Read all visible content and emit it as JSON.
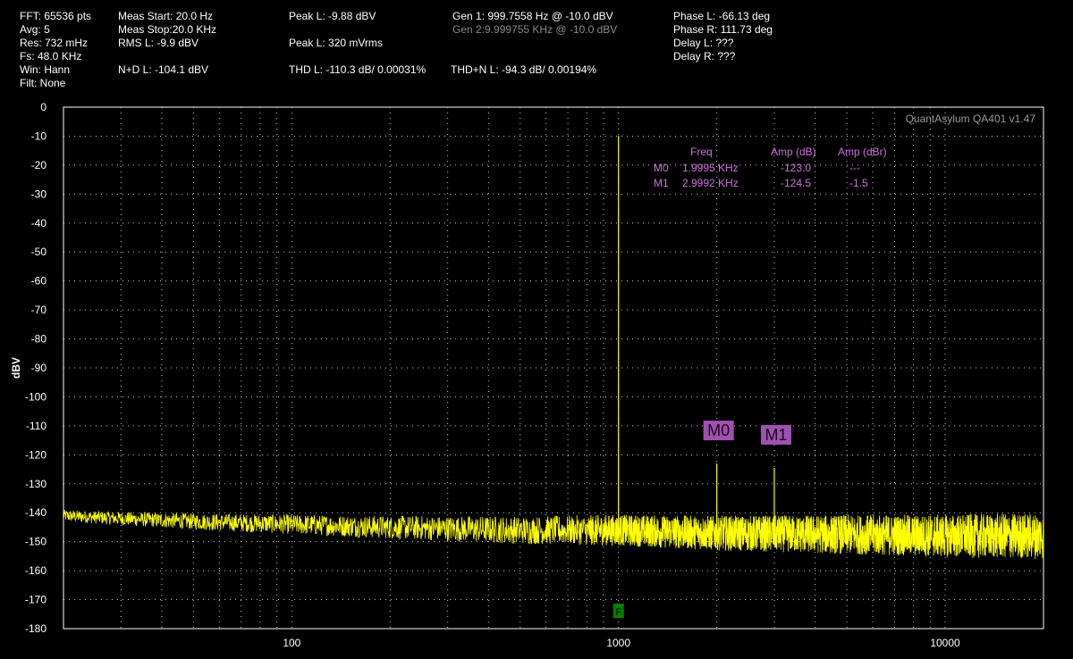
{
  "header": {
    "fft": "FFT: 65536 pts",
    "avg": "Avg: 5",
    "res": "Res: 732 mHz",
    "fs": "Fs: 48.0 KHz",
    "win": "Win: Hann",
    "filt": "Filt: None",
    "meas_start": "Meas Start: 20.0 Hz",
    "meas_stop": "Meas Stop:20.0 KHz",
    "rms": "RMS L: -9.9 dBV",
    "nd": "N+D L: -104.1 dBV",
    "peak_dbv": "Peak L: -9.88 dBV",
    "peak_mv": "Peak L: 320 mVrms",
    "thd": "THD L: -110.3 dB/ 0.00031%",
    "gen1": "Gen 1: 999.7558 Hz @ -10.0  dBV",
    "gen2": "Gen 2:9.999755 KHz @ -10.0  dBV",
    "thdn": "THD+N L: -94.3 dB/ 0.00194%",
    "phase_l": "Phase L: -66.13 deg",
    "phase_r": "Phase R: 111.73 deg",
    "delay_l": "Delay L: ???",
    "delay_r": "Delay R: ???"
  },
  "colors": {
    "background": "#000000",
    "trace": "#ffff00",
    "marker": "#d070e0",
    "marker_label_bg": "#a050b0",
    "grid": "#c8c8c8",
    "fundamental_marker": "#008000"
  },
  "marker_table": {
    "headers": [
      "Freq",
      "Amp (dB)",
      "Amp (dBr)"
    ],
    "rows": [
      {
        "name": "M0",
        "freq": "1.9995 KHz",
        "amp_db": "-123.0",
        "amp_dbr": "---"
      },
      {
        "name": "M1",
        "freq": "2.9992 KHz",
        "amp_db": "-124.5",
        "amp_dbr": "-1.5"
      }
    ]
  },
  "chart_data": {
    "type": "line",
    "watermark": "QuantAsylum QA401 v1.47",
    "xlabel": "",
    "ylabel": "dBV",
    "xscale": "log",
    "xlim": [
      20,
      20000
    ],
    "ylim": [
      -180,
      0
    ],
    "grid": true,
    "yticks": [
      0,
      -10,
      -20,
      -30,
      -40,
      -50,
      -60,
      -70,
      -80,
      -90,
      -100,
      -110,
      -120,
      -130,
      -140,
      -150,
      -160,
      -170,
      -180
    ],
    "xticks": [
      100,
      1000,
      10000
    ],
    "series": [
      {
        "color": "#ffff00",
        "noise_floor": [
          [
            20,
            -141
          ],
          [
            30,
            -142
          ],
          [
            50,
            -143
          ],
          [
            100,
            -144
          ],
          [
            200,
            -145
          ],
          [
            500,
            -146
          ],
          [
            1000,
            -146
          ],
          [
            2000,
            -147
          ],
          [
            5000,
            -147.5
          ],
          [
            10000,
            -148
          ],
          [
            20000,
            -148
          ]
        ],
        "peaks": [
          {
            "x": 1000,
            "y": -9.9
          },
          {
            "x": 1999.5,
            "y": -123.0
          },
          {
            "x": 2999.2,
            "y": -124.5
          }
        ]
      }
    ],
    "markers": [
      {
        "name": "M0",
        "x": 1999.5,
        "y": -123.0
      },
      {
        "name": "M1",
        "x": 2999.2,
        "y": -124.5
      }
    ],
    "fundamental_marker": {
      "label": "F",
      "x": 1000
    }
  }
}
